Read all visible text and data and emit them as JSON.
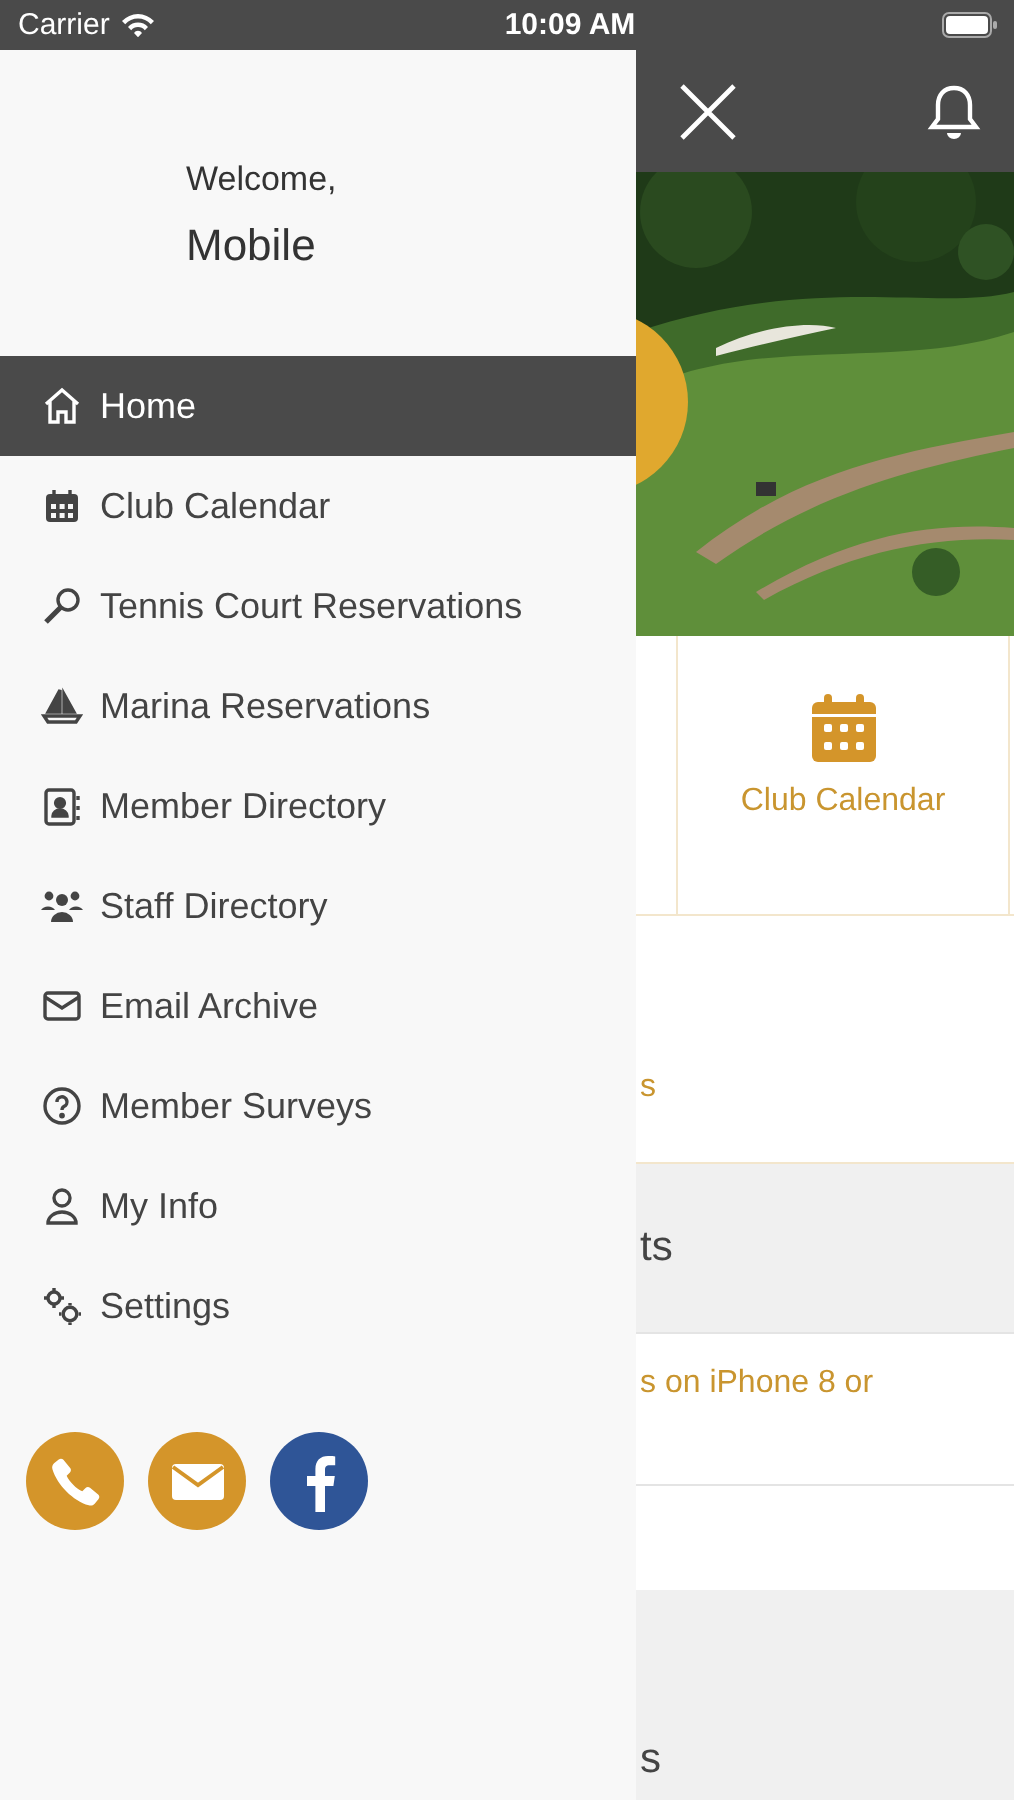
{
  "status_bar": {
    "carrier": "Carrier",
    "time": "10:09 AM"
  },
  "drawer": {
    "greeting": "Welcome,",
    "user_name": "Mobile",
    "menu": [
      {
        "label": "Home",
        "kind": "home",
        "selected": true
      },
      {
        "label": "Club Calendar",
        "kind": "calendar",
        "selected": false
      },
      {
        "label": "Tennis Court Reservations",
        "kind": "racket",
        "selected": false
      },
      {
        "label": "Marina Reservations",
        "kind": "boat",
        "selected": false
      },
      {
        "label": "Member Directory",
        "kind": "contact",
        "selected": false
      },
      {
        "label": "Staff Directory",
        "kind": "people",
        "selected": false
      },
      {
        "label": "Email Archive",
        "kind": "envelope",
        "selected": false
      },
      {
        "label": "Member Surveys",
        "kind": "question",
        "selected": false
      },
      {
        "label": "My Info",
        "kind": "person",
        "selected": false
      },
      {
        "label": "Settings",
        "kind": "gears",
        "selected": false
      }
    ],
    "social": [
      {
        "kind": "phone",
        "color": "#d4952a"
      },
      {
        "kind": "email",
        "color": "#d4952a"
      },
      {
        "kind": "facebook",
        "color": "#2f5597"
      }
    ]
  },
  "page_behind": {
    "sections": [
      {
        "kind": "tile",
        "label": "Club Calendar"
      },
      {
        "kind": "link",
        "text": "s"
      },
      {
        "kind": "heading",
        "text": "ts"
      },
      {
        "kind": "link_top",
        "text": "s on iPhone 8 or"
      },
      {
        "kind": "blank"
      },
      {
        "kind": "heading_low",
        "text": "s"
      }
    ]
  }
}
